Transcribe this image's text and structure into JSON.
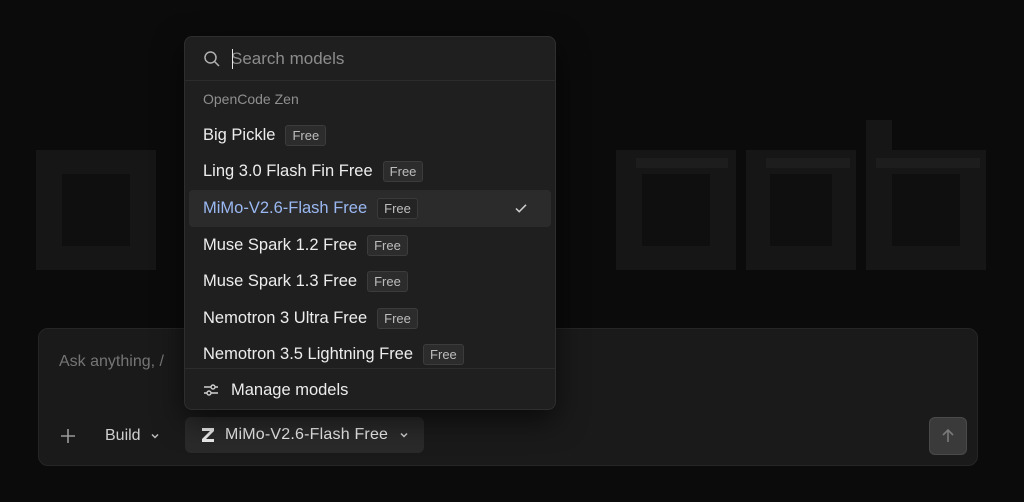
{
  "search": {
    "placeholder": "Search models"
  },
  "dropdown": {
    "group_label": "OpenCode Zen",
    "models": [
      {
        "name": "Big Pickle",
        "tag": "Free",
        "selected": false
      },
      {
        "name": "Ling 3.0 Flash Fin Free",
        "tag": "Free",
        "selected": false
      },
      {
        "name": "MiMo-V2.6-Flash Free",
        "tag": "Free",
        "selected": true
      },
      {
        "name": "Muse Spark 1.2 Free",
        "tag": "Free",
        "selected": false
      },
      {
        "name": "Muse Spark 1.3 Free",
        "tag": "Free",
        "selected": false
      },
      {
        "name": "Nemotron 3 Ultra Free",
        "tag": "Free",
        "selected": false
      },
      {
        "name": "Nemotron 3.5 Lightning Free",
        "tag": "Free",
        "selected": false
      }
    ],
    "manage_label": "Manage models"
  },
  "composer": {
    "placeholder": "Ask anything, /",
    "agent_label": "Build",
    "model_label": "MiMo-V2.6-Flash Free"
  },
  "icons": {
    "search": "search-icon",
    "check": "check-icon",
    "sliders": "sliders-icon",
    "add": "plus-icon",
    "chevron": "chevron-down-icon",
    "zen": "zen-logo-icon",
    "send": "arrow-up-icon"
  },
  "colors": {
    "background": "#0b0b0b",
    "panel": "#1f1f1f",
    "selected_text": "#9ab8f2",
    "muted": "#8f8f8f"
  }
}
